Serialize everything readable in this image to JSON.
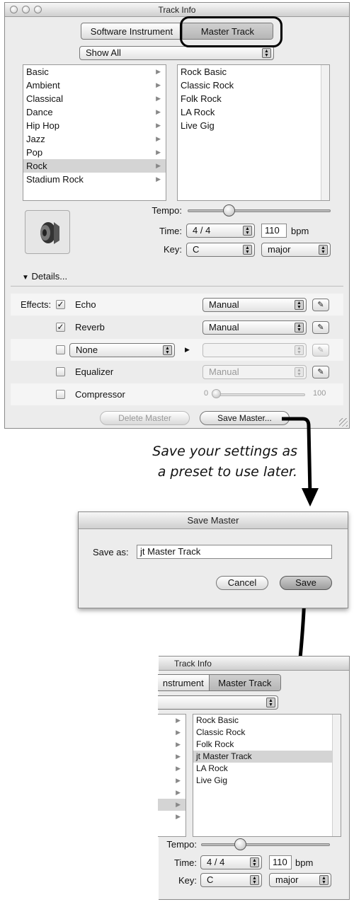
{
  "window1": {
    "title": "Track Info",
    "tabs": [
      "Software Instrument",
      "Master Track"
    ],
    "filter": "Show All",
    "categories": [
      {
        "label": "Basic"
      },
      {
        "label": "Ambient"
      },
      {
        "label": "Classical"
      },
      {
        "label": "Dance"
      },
      {
        "label": "Hip Hop"
      },
      {
        "label": "Jazz"
      },
      {
        "label": "Pop"
      },
      {
        "label": "Rock",
        "selected": true
      },
      {
        "label": "Stadium Rock"
      }
    ],
    "presets": [
      "Rock Basic",
      "Classic Rock",
      "Folk Rock",
      "LA Rock",
      "Live Gig"
    ],
    "tempo_label": "Tempo:",
    "time_label": "Time:",
    "time_signature": "4 / 4",
    "tempo_value": "110",
    "bpm_label": "bpm",
    "key_label": "Key:",
    "key_value": "C",
    "scale_value": "major",
    "details_label": "Details...",
    "effects_label": "Effects:",
    "effects": [
      {
        "name": "Echo",
        "checked": true,
        "preset": "Manual"
      },
      {
        "name": "Reverb",
        "checked": true,
        "preset": "Manual"
      },
      {
        "name": "None",
        "checked": false,
        "preset": ""
      },
      {
        "name": "Equalizer",
        "checked": false,
        "preset": "Manual"
      },
      {
        "name": "Compressor",
        "checked": false,
        "min": "0",
        "max": "100"
      }
    ],
    "delete_button": "Delete Master",
    "save_button": "Save Master..."
  },
  "caption": [
    "Save your settings as",
    "a preset to use later."
  ],
  "dialog": {
    "title": "Save Master",
    "save_as_label": "Save as:",
    "save_as_value": "jt Master Track",
    "cancel_button": "Cancel",
    "save_button": "Save"
  },
  "window2": {
    "title": "Track Info",
    "tab_left": "nstrument",
    "tab_right": "Master Track",
    "presets": [
      "Rock Basic",
      "Classic Rock",
      "Folk Rock",
      "jt Master Track",
      "LA Rock",
      "Live Gig"
    ],
    "tempo_label": "Tempo:",
    "time_label": "Time:",
    "time_signature": "4 / 4",
    "tempo_value": "110",
    "bpm_label": "bpm",
    "key_label": "Key:",
    "key_value": "C",
    "scale_value": "major"
  }
}
